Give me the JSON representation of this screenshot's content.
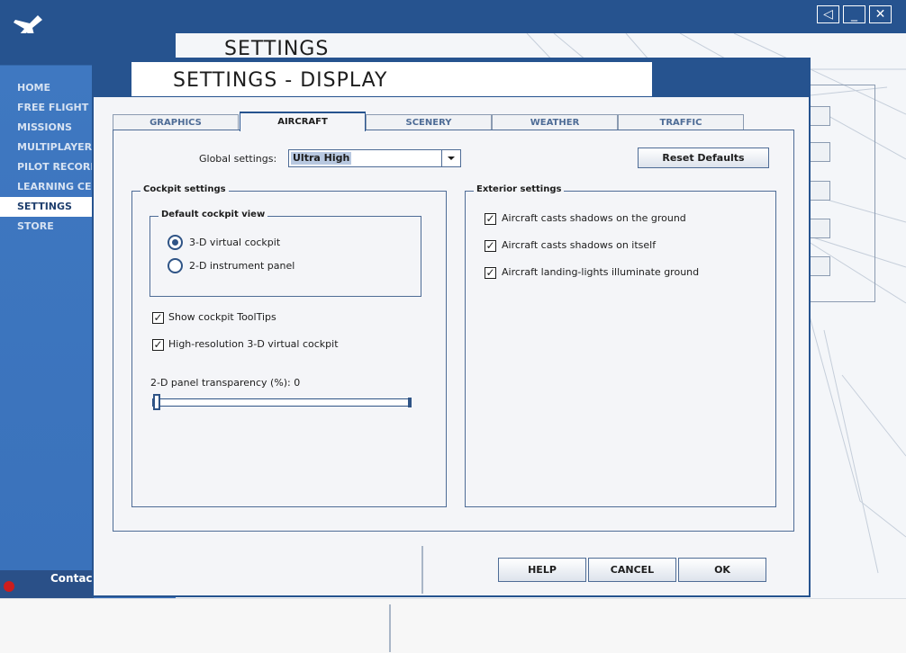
{
  "app": {
    "background_title": "SETTINGS",
    "nav": [
      {
        "label": "HOME",
        "active": false
      },
      {
        "label": "FREE FLIGHT",
        "active": false
      },
      {
        "label": "MISSIONS",
        "active": false
      },
      {
        "label": "MULTIPLAYER",
        "active": false
      },
      {
        "label": "PILOT RECORDS",
        "active": false
      },
      {
        "label": "LEARNING CENTER",
        "active": false
      },
      {
        "label": "SETTINGS",
        "active": true
      },
      {
        "label": "STORE",
        "active": false
      }
    ],
    "contact_label": "Contac",
    "window_buttons": [
      {
        "icon": "sound-icon",
        "glyph": "◁"
      },
      {
        "icon": "minimize-icon",
        "glyph": "_"
      },
      {
        "icon": "close-icon",
        "glyph": "✕"
      }
    ]
  },
  "dialog": {
    "title": "SETTINGS - DISPLAY",
    "tabs": [
      {
        "label": "GRAPHICS",
        "active": false
      },
      {
        "label": "AIRCRAFT",
        "active": true
      },
      {
        "label": "SCENERY",
        "active": false
      },
      {
        "label": "WEATHER",
        "active": false
      },
      {
        "label": "TRAFFIC",
        "active": false
      }
    ],
    "global_settings_label": "Global settings:",
    "global_settings_value": "Ultra High",
    "reset_defaults_label": "Reset Defaults",
    "cockpit": {
      "title": "Cockpit settings",
      "default_view_title": "Default cockpit view",
      "radios": [
        {
          "label": "3-D virtual cockpit",
          "selected": true
        },
        {
          "label": "2-D instrument panel",
          "selected": false
        }
      ],
      "checkboxes": [
        {
          "label": "Show cockpit ToolTips",
          "checked": true
        },
        {
          "label": "High-resolution 3-D virtual cockpit",
          "checked": true
        }
      ],
      "slider_label": "2-D panel transparency (%): 0",
      "slider_value_percent": 0
    },
    "exterior": {
      "title": "Exterior settings",
      "checkboxes": [
        {
          "label": "Aircraft casts shadows on the ground",
          "checked": true
        },
        {
          "label": "Aircraft casts shadows on itself",
          "checked": true
        },
        {
          "label": "Aircraft landing-lights illuminate ground",
          "checked": true
        }
      ]
    },
    "buttons": {
      "help": "HELP",
      "cancel": "CANCEL",
      "ok": "OK"
    }
  },
  "colors": {
    "primary_blue": "#26538f",
    "sidebar_blue": "#3a72bb",
    "accent_dark": "#2f5486",
    "contact_dot": "#cc1d1d"
  }
}
